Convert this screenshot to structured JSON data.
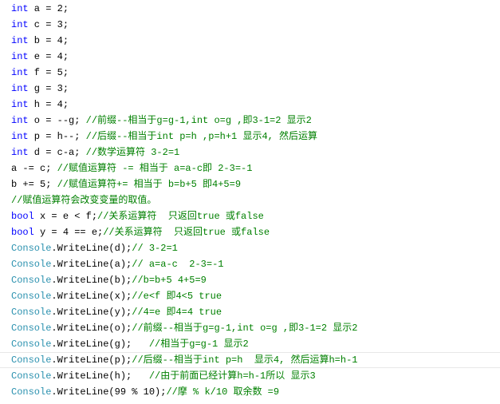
{
  "colors": {
    "kw": "#0000ff",
    "type": "#2b91af",
    "cm": "#008000",
    "tx": "#000000"
  },
  "lines": [
    [
      {
        "c": "kw",
        "t": "int"
      },
      {
        "c": "tx",
        "t": " a = 2;"
      }
    ],
    [
      {
        "c": "kw",
        "t": "int"
      },
      {
        "c": "tx",
        "t": " c = 3;"
      }
    ],
    [
      {
        "c": "kw",
        "t": "int"
      },
      {
        "c": "tx",
        "t": " b = 4;"
      }
    ],
    [
      {
        "c": "kw",
        "t": "int"
      },
      {
        "c": "tx",
        "t": " e = 4;"
      }
    ],
    [
      {
        "c": "kw",
        "t": "int"
      },
      {
        "c": "tx",
        "t": " f = 5;"
      }
    ],
    [
      {
        "c": "kw",
        "t": "int"
      },
      {
        "c": "tx",
        "t": " g = 3;"
      }
    ],
    [
      {
        "c": "kw",
        "t": "int"
      },
      {
        "c": "tx",
        "t": " h = 4;"
      }
    ],
    [
      {
        "c": "kw",
        "t": "int"
      },
      {
        "c": "tx",
        "t": " o = --g; "
      },
      {
        "c": "cm",
        "t": "//前缀--相当于g=g-1,int o=g ,即3-1=2 显示2"
      }
    ],
    [
      {
        "c": "kw",
        "t": "int"
      },
      {
        "c": "tx",
        "t": " p = h--; "
      },
      {
        "c": "cm",
        "t": "//后缀--相当于int p=h ,p=h+1 显示4, 然后运算"
      }
    ],
    [
      {
        "c": "kw",
        "t": "int"
      },
      {
        "c": "tx",
        "t": " d = c-a; "
      },
      {
        "c": "cm",
        "t": "//数学运算符 3-2=1"
      }
    ],
    [
      {
        "c": "tx",
        "t": "a -= c; "
      },
      {
        "c": "cm",
        "t": "//赋值运算符 -= 相当于 a=a-c即 2-3=-1"
      }
    ],
    [
      {
        "c": "tx",
        "t": "b += 5; "
      },
      {
        "c": "cm",
        "t": "//赋值运算符+= 相当于 b=b+5 即4+5=9"
      }
    ],
    [
      {
        "c": "cm",
        "t": "//赋值运算符会改变变量的取值。"
      }
    ],
    [
      {
        "c": "kw",
        "t": "bool"
      },
      {
        "c": "tx",
        "t": " x = e < f;"
      },
      {
        "c": "cm",
        "t": "//关系运算符  只返回true 或false"
      }
    ],
    [
      {
        "c": "kw",
        "t": "bool"
      },
      {
        "c": "tx",
        "t": " y = 4 == e;"
      },
      {
        "c": "cm",
        "t": "//关系运算符  只返回true 或false"
      }
    ],
    [
      {
        "c": "type",
        "t": "Console"
      },
      {
        "c": "tx",
        "t": ".WriteLine(d);"
      },
      {
        "c": "cm",
        "t": "// 3-2=1"
      }
    ],
    [
      {
        "c": "type",
        "t": "Console"
      },
      {
        "c": "tx",
        "t": ".WriteLine(a);"
      },
      {
        "c": "cm",
        "t": "// a=a-c  2-3=-1"
      }
    ],
    [
      {
        "c": "type",
        "t": "Console"
      },
      {
        "c": "tx",
        "t": ".WriteLine(b);"
      },
      {
        "c": "cm",
        "t": "//b=b+5 4+5=9"
      }
    ],
    [
      {
        "c": "type",
        "t": "Console"
      },
      {
        "c": "tx",
        "t": ".WriteLine(x);"
      },
      {
        "c": "cm",
        "t": "//e<f 即4<5 true"
      }
    ],
    [
      {
        "c": "type",
        "t": "Console"
      },
      {
        "c": "tx",
        "t": ".WriteLine(y);"
      },
      {
        "c": "cm",
        "t": "//4=e 即4=4 true"
      }
    ],
    [
      {
        "c": "type",
        "t": "Console"
      },
      {
        "c": "tx",
        "t": ".WriteLine(o);"
      },
      {
        "c": "cm",
        "t": "//前缀--相当于g=g-1,int o=g ,即3-1=2 显示2"
      }
    ],
    [
      {
        "c": "type",
        "t": "Console"
      },
      {
        "c": "tx",
        "t": ".WriteLine(g);   "
      },
      {
        "c": "cm",
        "t": "//相当于g=g-1 显示2"
      }
    ],
    [
      {
        "c": "type",
        "t": "Console"
      },
      {
        "c": "tx",
        "t": ".WriteLine(p);"
      },
      {
        "c": "cm",
        "t": "//后缀--相当于int p=h  显示4, 然后运算h=h-1"
      }
    ],
    [
      {
        "c": "type",
        "t": "Console"
      },
      {
        "c": "tx",
        "t": ".WriteLine(h);   "
      },
      {
        "c": "cm",
        "t": "//由于前面已经计算h=h-1所以 显示3"
      }
    ],
    [
      {
        "c": "type",
        "t": "Console"
      },
      {
        "c": "tx",
        "t": ".WriteLine(99 % 10);"
      },
      {
        "c": "cm",
        "t": "//摩 % k/10 取余数 =9"
      }
    ]
  ],
  "current_line": 22
}
